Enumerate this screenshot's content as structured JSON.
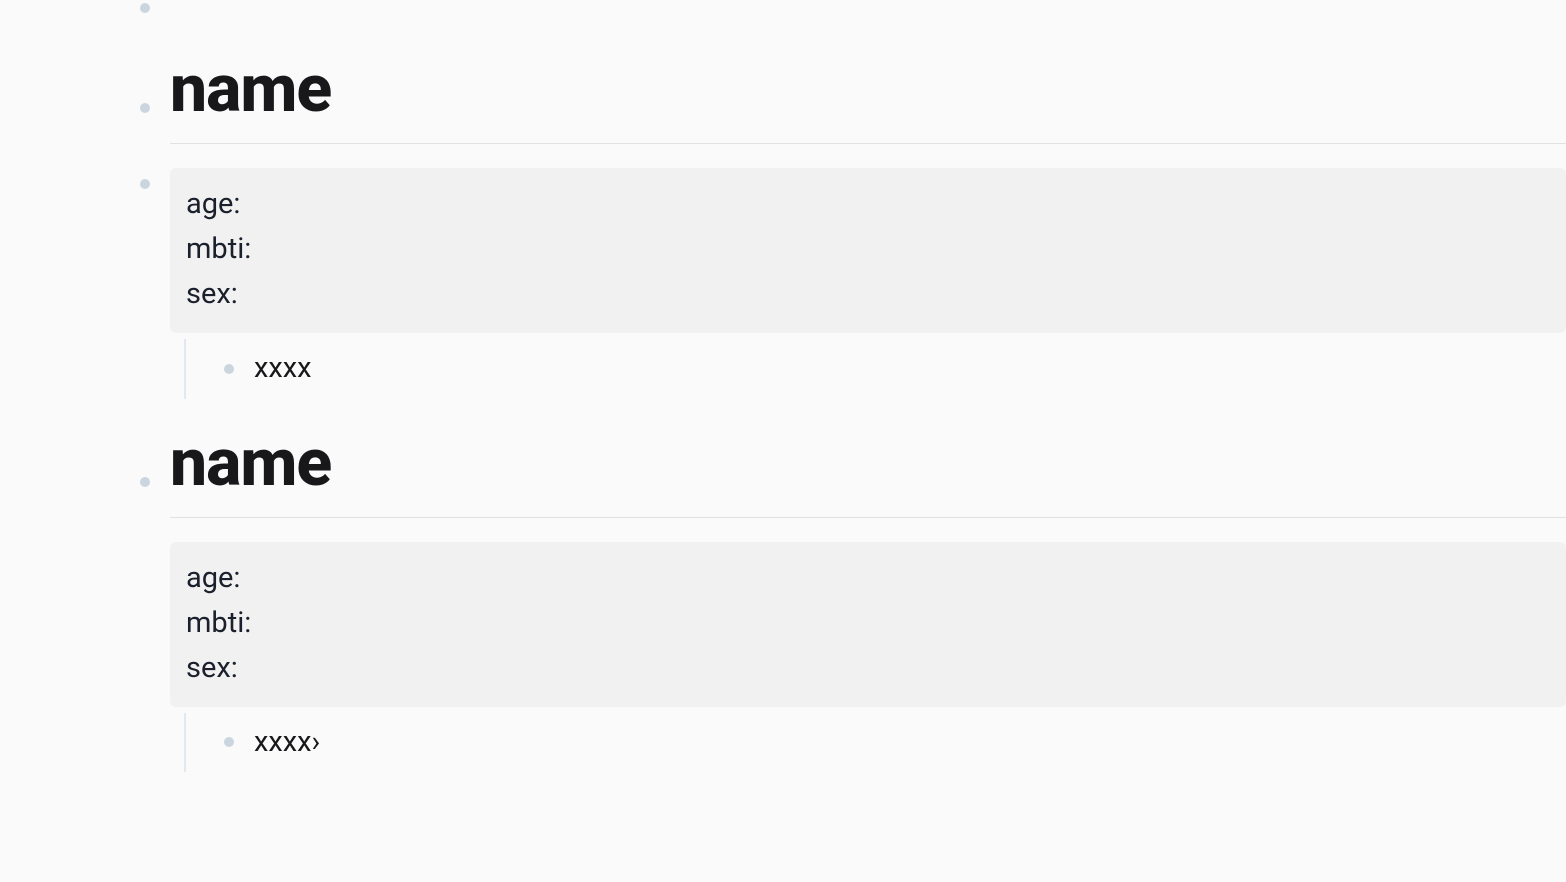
{
  "sections": [
    {
      "heading": "name",
      "fields": "age:\nmbti:\nsex:",
      "note": "xxxx"
    },
    {
      "heading": "name",
      "fields": "age:\nmbti:\nsex:",
      "note": "xxxx›"
    }
  ]
}
